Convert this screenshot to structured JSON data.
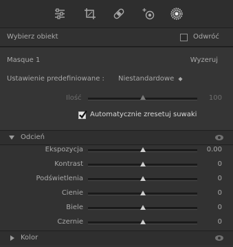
{
  "toolbar": {
    "tools": [
      {
        "icon": "sliders-icon"
      },
      {
        "icon": "crop-icon"
      },
      {
        "icon": "bandage-icon"
      },
      {
        "icon": "redeye-icon"
      },
      {
        "icon": "mask-brush-icon"
      }
    ]
  },
  "select_object": {
    "label": "Wybierz obiekt",
    "invert_label": "Odwróć",
    "invert_checked": false
  },
  "mask": {
    "name": "Masque 1",
    "reset_label": "Wyzeruj",
    "preset_label": "Ustawienie predefiniowane :",
    "preset_value": "Niestandardowe",
    "amount_label": "Ilość",
    "amount_value": "100",
    "amount_fraction": 0.5,
    "auto_reset_label": "Automatycznie zresetuj suwaki",
    "auto_reset_checked": true
  },
  "tone_section": {
    "title": "Odcień",
    "expanded": true,
    "sliders": [
      {
        "label": "Ekspozycja",
        "value": "0.00",
        "fraction": 0.5
      },
      {
        "label": "Kontrast",
        "value": "0",
        "fraction": 0.5
      },
      {
        "label": "Podświetlenia",
        "value": "0",
        "fraction": 0.5
      },
      {
        "label": "Cienie",
        "value": "0",
        "fraction": 0.5
      },
      {
        "label": "Biele",
        "value": "0",
        "fraction": 0.5
      },
      {
        "label": "Czernie",
        "value": "0",
        "fraction": 0.5
      }
    ]
  },
  "color_section": {
    "title": "Kolor",
    "expanded": false
  },
  "colors": {
    "panel_bg": "#323232",
    "text": "#a9a9a9",
    "thumb": "#cfcfcf"
  }
}
